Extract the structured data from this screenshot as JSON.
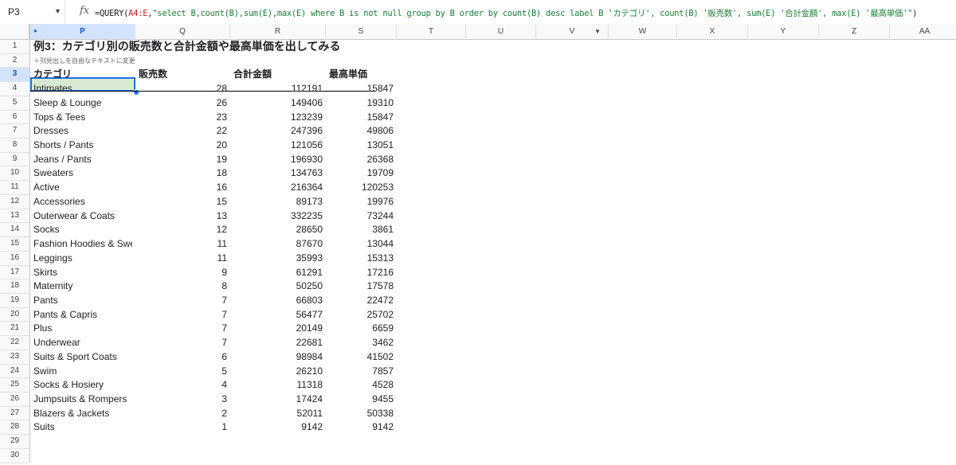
{
  "formula_bar": {
    "name_box": "P3",
    "fx_label": "fx",
    "formula_parts": [
      {
        "text": "=QUERY(",
        "kind": "plain"
      },
      {
        "text": "A4:E",
        "kind": "ref"
      },
      {
        "text": ",",
        "kind": "plain"
      },
      {
        "text": "\"select B,count(B),sum(E),max(E) where B is not null group by B order by count(B) desc label B 'カテゴリ', count(B) '販売数', sum(E) '合計金額', max(E) '最高単価'\"",
        "kind": "str"
      },
      {
        "text": ")",
        "kind": "plain"
      }
    ]
  },
  "columns": [
    "P",
    "Q",
    "R",
    "S",
    "T",
    "U",
    "V",
    "W",
    "X",
    "Y",
    "Z",
    "AA"
  ],
  "rows": [
    "1",
    "2",
    "3",
    "4",
    "5",
    "6",
    "7",
    "8",
    "9",
    "10",
    "11",
    "12",
    "13",
    "14",
    "15",
    "16",
    "17",
    "18",
    "19",
    "20",
    "21",
    "22",
    "23",
    "24",
    "25",
    "26",
    "27",
    "28",
    "29",
    "30"
  ],
  "sheet": {
    "title": "例3：カテゴリ別の販売数と合計金額や最高単価を出してみる",
    "note": "＋列見出しを自由なテキストに変更",
    "headers": [
      "カテゴリ",
      "販売数",
      "合計金額",
      "最高単価"
    ],
    "data_rows": [
      [
        "Intimates",
        "28",
        "112191",
        "15847"
      ],
      [
        "Sleep & Lounge",
        "26",
        "149406",
        "19310"
      ],
      [
        "Tops & Tees",
        "23",
        "123239",
        "15847"
      ],
      [
        "Dresses",
        "22",
        "247396",
        "49806"
      ],
      [
        "Shorts / Pants",
        "20",
        "121056",
        "13051"
      ],
      [
        "Jeans / Pants",
        "19",
        "196930",
        "26368"
      ],
      [
        "Sweaters",
        "18",
        "134763",
        "19709"
      ],
      [
        "Active",
        "16",
        "216364",
        "120253"
      ],
      [
        "Accessories",
        "15",
        "89173",
        "19976"
      ],
      [
        "Outerwear & Coats",
        "13",
        "332235",
        "73244"
      ],
      [
        "Socks",
        "12",
        "28650",
        "3861"
      ],
      [
        "Fashion Hoodies & Sweat",
        "11",
        "87670",
        "13044"
      ],
      [
        "Leggings",
        "11",
        "35993",
        "15313"
      ],
      [
        "Skirts",
        "9",
        "61291",
        "17216"
      ],
      [
        "Maternity",
        "8",
        "50250",
        "17578"
      ],
      [
        "Pants",
        "7",
        "66803",
        "22472"
      ],
      [
        "Pants & Capris",
        "7",
        "56477",
        "25702"
      ],
      [
        "Plus",
        "7",
        "20149",
        "6659"
      ],
      [
        "Underwear",
        "7",
        "22681",
        "3462"
      ],
      [
        "Suits & Sport Coats",
        "6",
        "98984",
        "41502"
      ],
      [
        "Swim",
        "5",
        "26210",
        "7857"
      ],
      [
        "Socks & Hosiery",
        "4",
        "11318",
        "4528"
      ],
      [
        "Jumpsuits & Rompers",
        "3",
        "17424",
        "9455"
      ],
      [
        "Blazers & Jackets",
        "2",
        "52011",
        "50338"
      ],
      [
        "Suits",
        "1",
        "9142",
        "9142"
      ]
    ]
  }
}
